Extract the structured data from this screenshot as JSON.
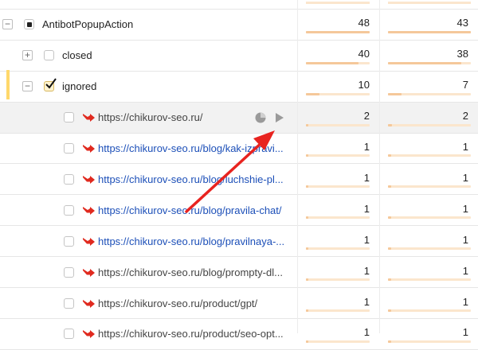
{
  "colors": {
    "accent_bar": "#f5c89a",
    "accent_track": "#fbe6cd",
    "link": "#1c4fb8",
    "annotation_arrow": "#e8231f",
    "selected_marker": "#ffd86b"
  },
  "rows": [
    {
      "label": "AntibotPopupAction",
      "tree": "−",
      "checkbox": "partial",
      "col1": "48",
      "col1_fraction": 1.0,
      "col2": "43",
      "col2_fraction": 1.0
    },
    {
      "label": "closed",
      "tree": "+",
      "checkbox": "empty",
      "col1": "40",
      "col1_fraction": 0.83,
      "col2": "38",
      "col2_fraction": 0.88
    },
    {
      "label": "ignored",
      "tree": "−",
      "checkbox": "checked",
      "col1": "10",
      "col1_fraction": 0.21,
      "col2": "7",
      "col2_fraction": 0.16
    },
    {
      "label": "https://chikurov-seo.ru/",
      "is_link": false,
      "icon": "redirect-arrow-icon",
      "actions": [
        "pie-chart-icon",
        "play-icon"
      ],
      "col1": "2",
      "col1_fraction": 0.04,
      "col2": "2",
      "col2_fraction": 0.05
    },
    {
      "label": "https://chikurov-seo.ru/blog/kak-izpravi...",
      "is_link": true,
      "icon": "redirect-arrow-icon",
      "col1": "1",
      "col1_fraction": 0.02,
      "col2": "1",
      "col2_fraction": 0.02
    },
    {
      "label": "https://chikurov-seo.ru/blog/luchshie-pl...",
      "is_link": true,
      "icon": "redirect-arrow-icon",
      "col1": "1",
      "col1_fraction": 0.02,
      "col2": "1",
      "col2_fraction": 0.02
    },
    {
      "label": "https://chikurov-seo.ru/blog/pravila-chat/",
      "is_link": true,
      "icon": "redirect-arrow-icon",
      "col1": "1",
      "col1_fraction": 0.02,
      "col2": "1",
      "col2_fraction": 0.02
    },
    {
      "label": "https://chikurov-seo.ru/blog/pravilnaya-...",
      "is_link": true,
      "icon": "redirect-arrow-icon",
      "col1": "1",
      "col1_fraction": 0.02,
      "col2": "1",
      "col2_fraction": 0.02
    },
    {
      "label": "https://chikurov-seo.ru/blog/prompty-dl...",
      "is_link": false,
      "icon": "redirect-arrow-icon",
      "col1": "1",
      "col1_fraction": 0.02,
      "col2": "1",
      "col2_fraction": 0.02
    },
    {
      "label": "https://chikurov-seo.ru/product/gpt/",
      "is_link": false,
      "icon": "redirect-arrow-icon",
      "col1": "1",
      "col1_fraction": 0.02,
      "col2": "1",
      "col2_fraction": 0.02
    },
    {
      "label": "https://chikurov-seo.ru/product/seo-opt...",
      "is_link": false,
      "icon": "redirect-arrow-icon",
      "col1": "1",
      "col1_fraction": 0.02,
      "col2": "1",
      "col2_fraction": 0.02
    }
  ]
}
